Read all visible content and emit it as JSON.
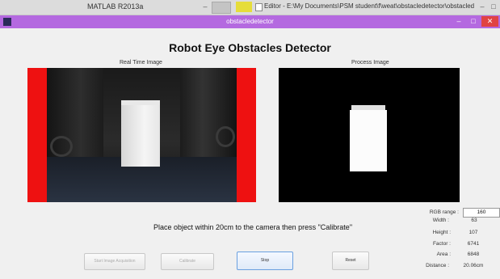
{
  "taskbar": {
    "app_title": "MATLAB R2013a",
    "editor_title": "Editor - E:\\My Documents\\PSM student\\f\\weat\\obstacledetector\\obstacledetector..."
  },
  "window": {
    "title": "obstacledetector",
    "minimize": "–",
    "maximize": "□",
    "close": "✕"
  },
  "heading": "Robot Eye Obstacles Detector",
  "panels": {
    "realtime_caption": "Real Time Image",
    "process_caption": "Process Image"
  },
  "instruction": "Place object within 20cm to the camera then press \"Calibrate\"",
  "buttons": {
    "start_label": "Start Image Acquisition",
    "calibrate_label": "Calibrate",
    "stop_label": "Stop",
    "reset_label": "Reset"
  },
  "stats": {
    "rgb_label": "RGB range :",
    "rgb_value": "160",
    "width_label": "Width :",
    "width_value": "63",
    "height_label": "Height :",
    "height_value": "107",
    "factor_label": "Factor :",
    "factor_value": "6741",
    "area_label": "Area :",
    "area_value": "6848",
    "distance_label": "Distance :",
    "distance_value": "20.06cm"
  },
  "colors": {
    "titlebar": "#b469e0",
    "detection_border": "#ee1111",
    "close_button": "#e04343"
  }
}
